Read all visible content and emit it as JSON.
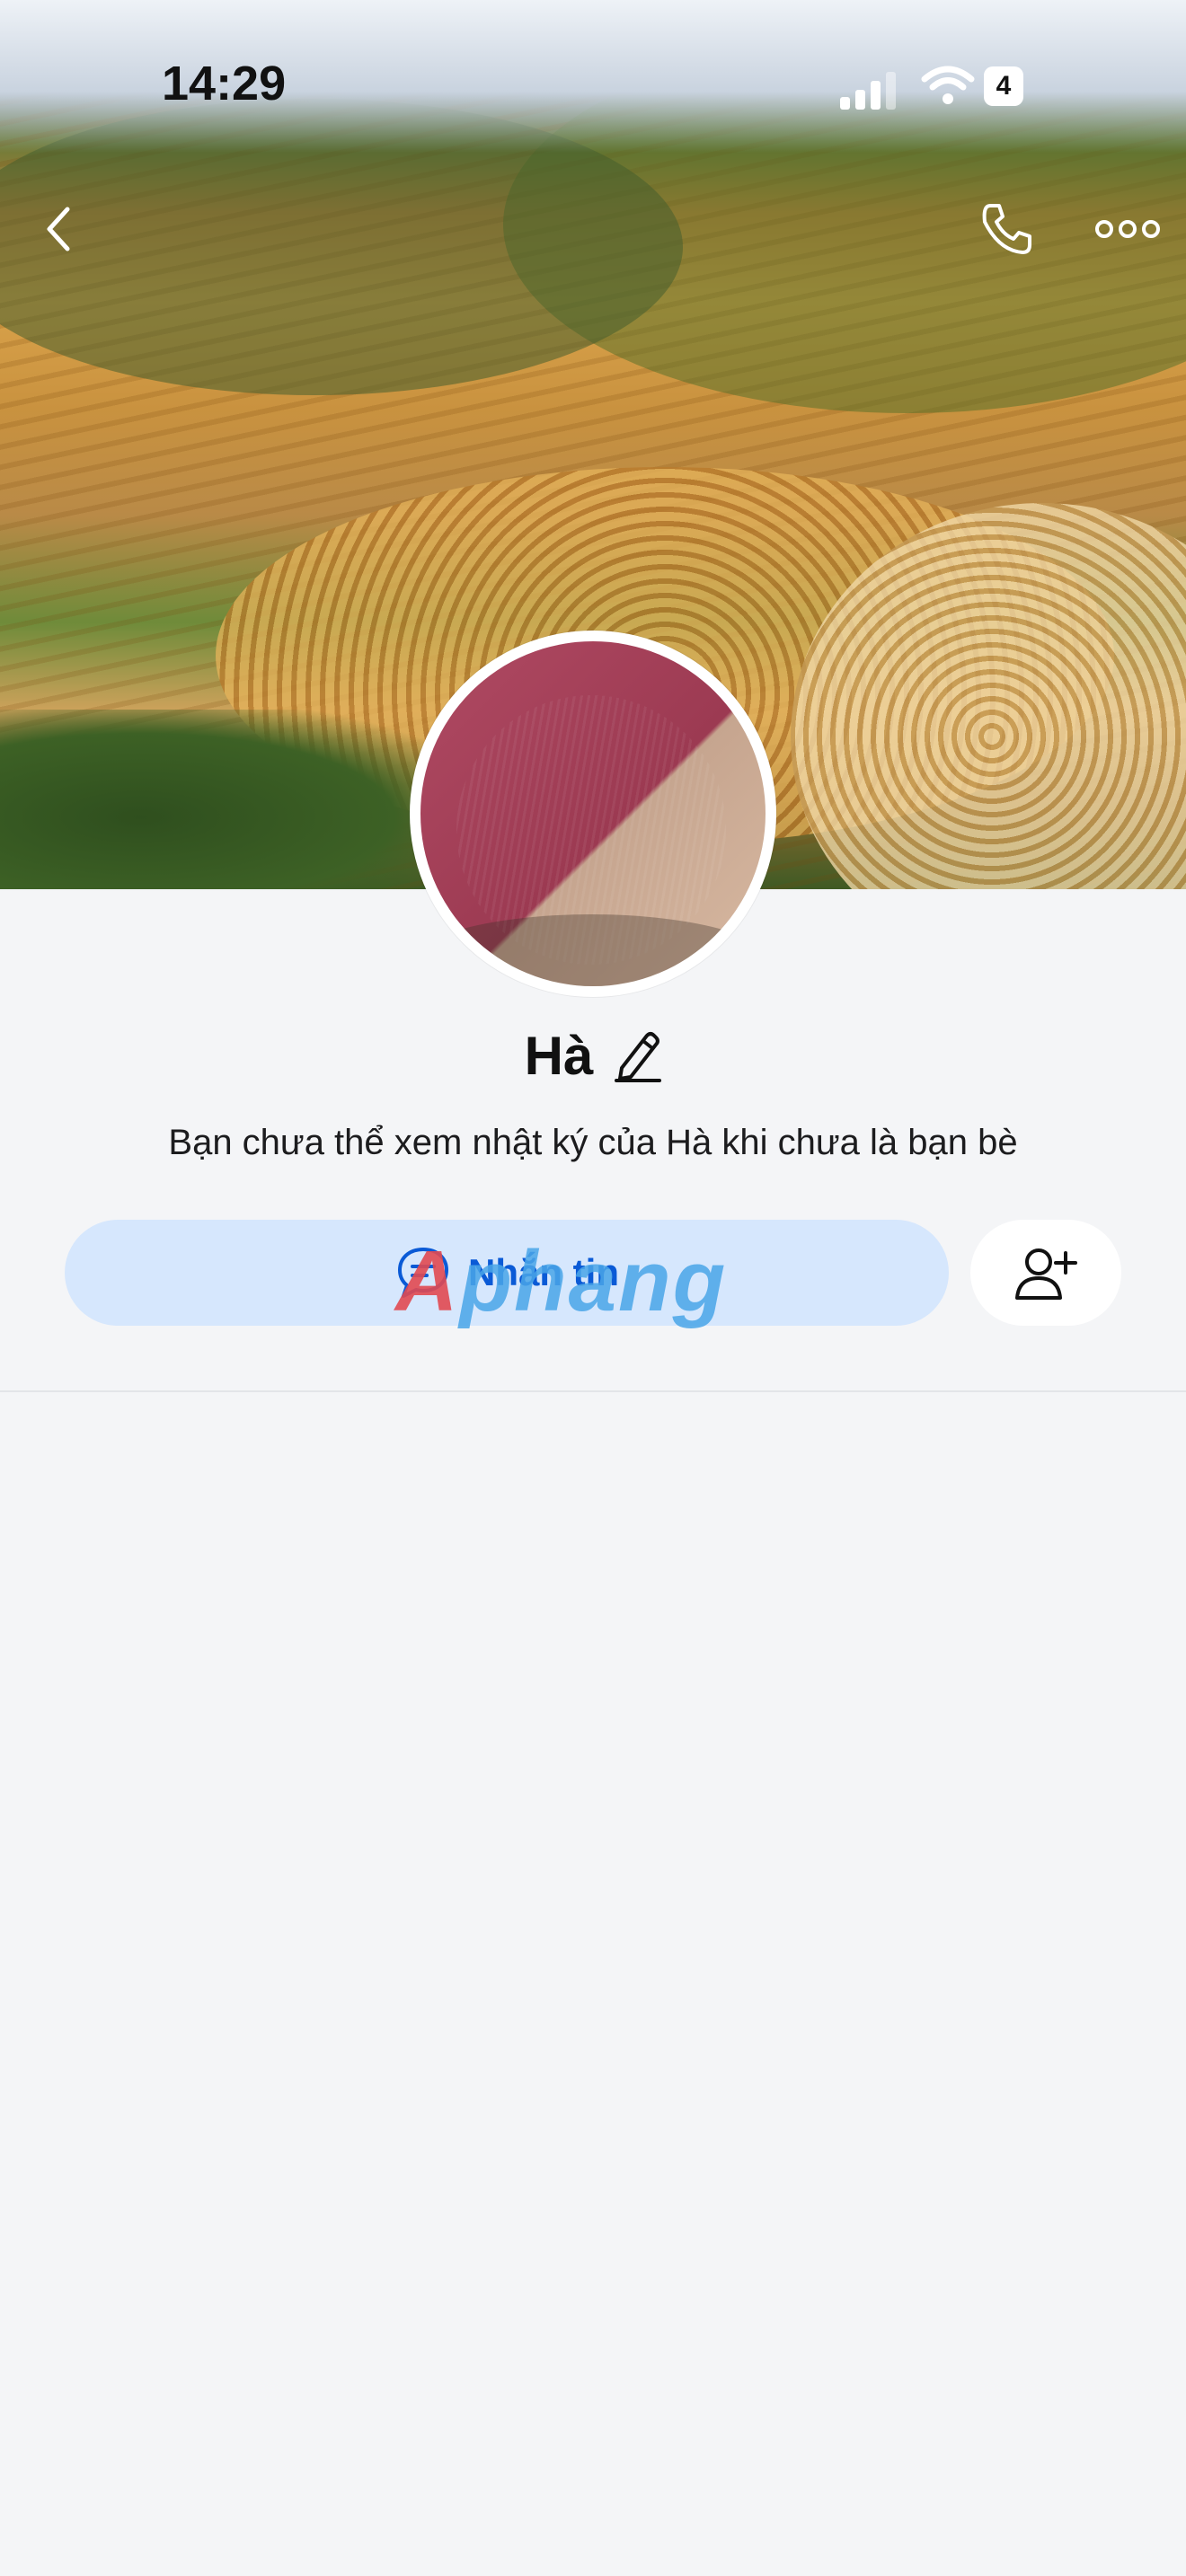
{
  "status_bar": {
    "time": "14:29",
    "battery": "4",
    "signal_level": "3 of 4 bars"
  },
  "nav": {
    "back_icon": "chevron-left-icon",
    "call_icon": "phone-icon",
    "more_icon": "more-horizontal-icon"
  },
  "profile": {
    "name": "Hà",
    "edit_icon": "pencil-icon",
    "notice": "Bạn chưa thể xem nhật ký của Hà khi chưa là bạn bè"
  },
  "actions": {
    "message_label": "Nhắn tin",
    "message_icon": "chat-bubble-icon",
    "add_friend_icon": "add-user-icon"
  },
  "watermark": {
    "first": "A",
    "rest": "phang"
  },
  "colors": {
    "background": "#f4f5f7",
    "message_button_bg": "#d6e7fd",
    "message_text": "#0a5ad6",
    "watermark_red": "#e24a52",
    "watermark_blue": "#4aa6e8"
  }
}
